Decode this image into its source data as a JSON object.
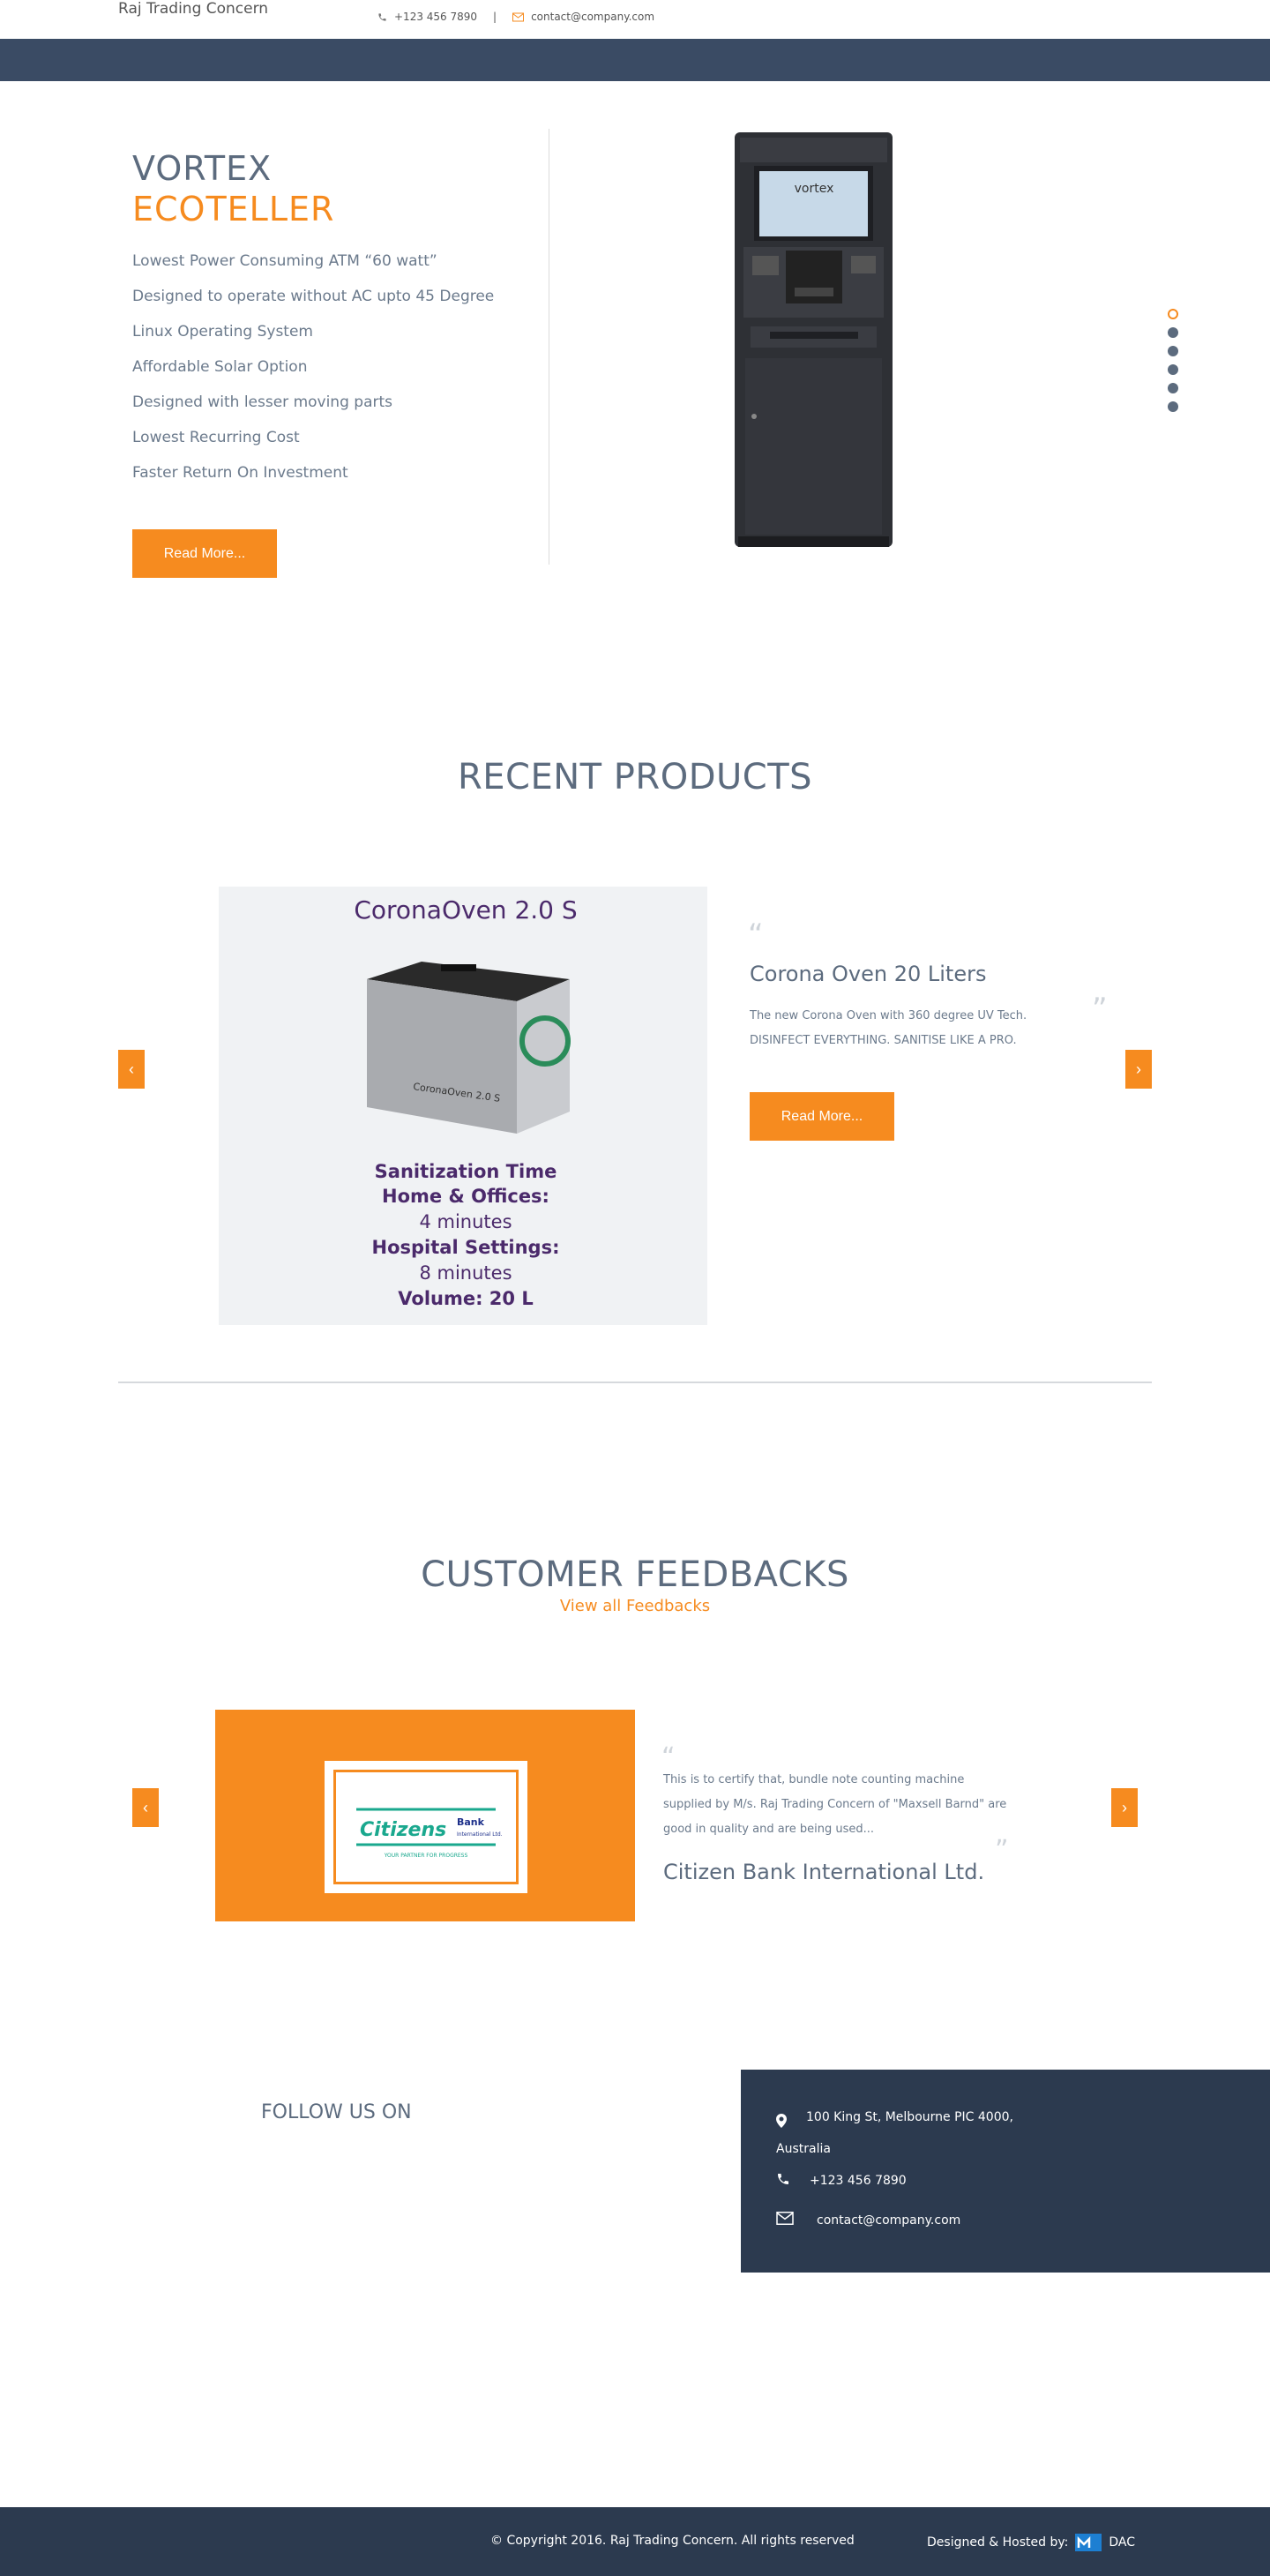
{
  "topbar": {
    "brand": "Raj Trading Concern",
    "phone": "+123 456 7890",
    "separator": "|",
    "email": "contact@company.com"
  },
  "hero": {
    "title_line1": "VORTEX",
    "title_line2": "ECOTELLER",
    "features": [
      "Lowest Power Consuming ATM “60 watt”",
      "Designed to operate without AC upto 45 Degree",
      "Linux Operating System",
      "Affordable Solar Option",
      "Designed with lesser moving parts",
      "Lowest Recurring Cost",
      "Faster Return On Investment"
    ],
    "button": "Read More...",
    "atm_screen_text": "vortex",
    "slide_count": 6,
    "active_slide": 1
  },
  "recent_products": {
    "title": "RECENT PRODUCTS",
    "image": {
      "heading": "CoronaOven 2.0 S",
      "box_label": "CoronaOven 2.0 S",
      "lines": [
        "Sanitization Time",
        "Home & Offices:",
        "4 minutes",
        "Hospital Settings:",
        "8 minutes",
        "Volume: 20 L"
      ]
    },
    "name": "Corona Oven 20 Liters",
    "description": "The new Corona Oven with 360 degree UV Tech. DISINFECT EVERYTHING. SANITISE LIKE A PRO.",
    "button": "Read More...",
    "prev": "‹",
    "next": "›"
  },
  "feedbacks": {
    "title": "CUSTOMER FEEDBACKS",
    "view_all": "View all Feedbacks",
    "logo_brand": "Citizens",
    "logo_bank": "Bank",
    "logo_bank_sub": "International Ltd.",
    "logo_tagline": "YOUR PARTNER FOR PROGRESS",
    "text": "This is to certify that, bundle note counting machine supplied by M/s. Raj Trading Concern of \"Maxsell Barnd\" are good in quality and are being used...",
    "name": "Citizen Bank International Ltd.",
    "prev": "‹",
    "next": "›"
  },
  "footer": {
    "follow": "FOLLOW US ON",
    "address": "100 King St, Melbourne PIC 4000, Australia",
    "phone": "+123 456 7890",
    "email": "contact@company.com",
    "copyright": "© Copyright 2016. Raj Trading Concern. All rights reserved",
    "designed": "Designed & Hosted by:",
    "designer": "DAC"
  },
  "colors": {
    "accent": "#f68b1f",
    "navy": "#3a4b64",
    "footer": "#2c3a4f",
    "text": "#5c6b7e"
  }
}
